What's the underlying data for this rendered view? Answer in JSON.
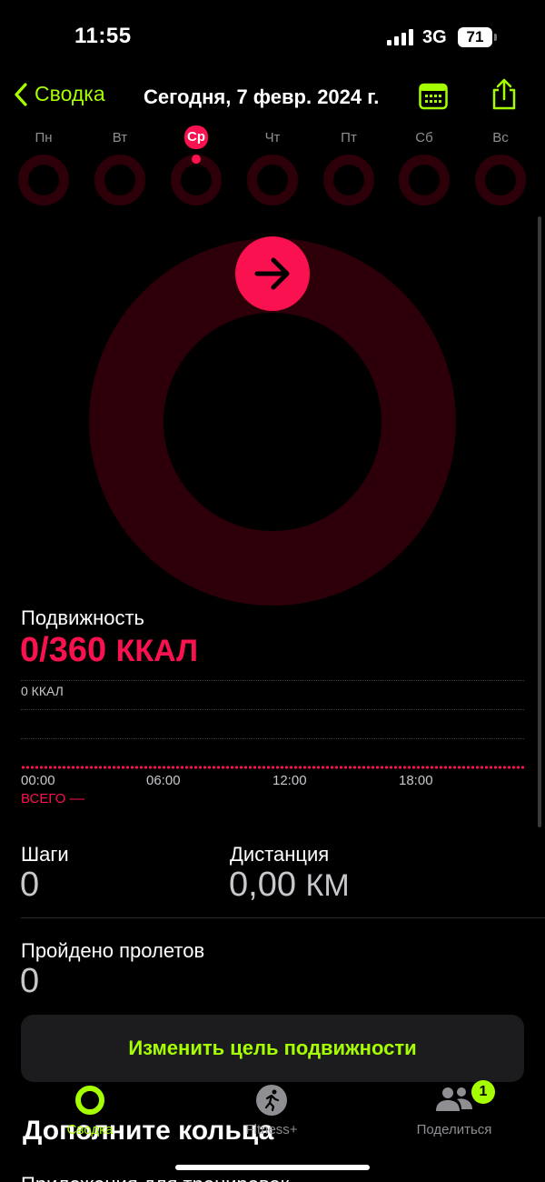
{
  "status": {
    "time": "11:55",
    "network": "3G",
    "battery": "71"
  },
  "nav": {
    "back_label": "Сводка",
    "title": "Сегодня, 7 февр. 2024 г."
  },
  "week": {
    "days": [
      "Пн",
      "Вт",
      "Ср",
      "Чт",
      "Пт",
      "Сб",
      "Вс"
    ],
    "selected": "Ср"
  },
  "move": {
    "title": "Подвижность",
    "value": "0/360",
    "unit": "ККАЛ",
    "axis_top": "0 ККАЛ",
    "ticks": [
      "00:00",
      "06:00",
      "12:00",
      "18:00"
    ],
    "total": "ВСЕГО ––"
  },
  "stats": {
    "steps_label": "Шаги",
    "steps_value": "0",
    "distance_label": "Дистанция",
    "distance_value": "0,00",
    "distance_unit": "КМ",
    "flights_label": "Пройдено пролетов",
    "flights_value": "0"
  },
  "goal_button": "Изменить цель подвижности",
  "tabs": {
    "summary": "Сводка",
    "fitness": "Fitness+",
    "share": "Поделиться",
    "share_badge": "1"
  },
  "section_heading": "Дополните кольца",
  "next_heading": "Приложения для тренировок",
  "colors": {
    "accent": "#a6ff00",
    "move": "#fa114f",
    "ring_track": "#2d0009"
  },
  "icons": {
    "back": "chevron-left-icon",
    "calendar": "calendar-icon",
    "share": "share-icon",
    "arrow": "arrow-right-icon"
  }
}
